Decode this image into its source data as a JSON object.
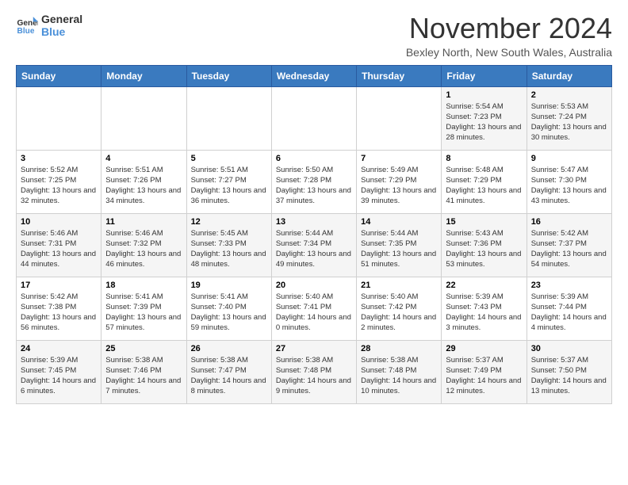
{
  "header": {
    "logo_line1": "General",
    "logo_line2": "Blue",
    "month": "November 2024",
    "location": "Bexley North, New South Wales, Australia"
  },
  "weekdays": [
    "Sunday",
    "Monday",
    "Tuesday",
    "Wednesday",
    "Thursday",
    "Friday",
    "Saturday"
  ],
  "weeks": [
    [
      {
        "day": "",
        "info": ""
      },
      {
        "day": "",
        "info": ""
      },
      {
        "day": "",
        "info": ""
      },
      {
        "day": "",
        "info": ""
      },
      {
        "day": "",
        "info": ""
      },
      {
        "day": "1",
        "info": "Sunrise: 5:54 AM\nSunset: 7:23 PM\nDaylight: 13 hours and 28 minutes."
      },
      {
        "day": "2",
        "info": "Sunrise: 5:53 AM\nSunset: 7:24 PM\nDaylight: 13 hours and 30 minutes."
      }
    ],
    [
      {
        "day": "3",
        "info": "Sunrise: 5:52 AM\nSunset: 7:25 PM\nDaylight: 13 hours and 32 minutes."
      },
      {
        "day": "4",
        "info": "Sunrise: 5:51 AM\nSunset: 7:26 PM\nDaylight: 13 hours and 34 minutes."
      },
      {
        "day": "5",
        "info": "Sunrise: 5:51 AM\nSunset: 7:27 PM\nDaylight: 13 hours and 36 minutes."
      },
      {
        "day": "6",
        "info": "Sunrise: 5:50 AM\nSunset: 7:28 PM\nDaylight: 13 hours and 37 minutes."
      },
      {
        "day": "7",
        "info": "Sunrise: 5:49 AM\nSunset: 7:29 PM\nDaylight: 13 hours and 39 minutes."
      },
      {
        "day": "8",
        "info": "Sunrise: 5:48 AM\nSunset: 7:29 PM\nDaylight: 13 hours and 41 minutes."
      },
      {
        "day": "9",
        "info": "Sunrise: 5:47 AM\nSunset: 7:30 PM\nDaylight: 13 hours and 43 minutes."
      }
    ],
    [
      {
        "day": "10",
        "info": "Sunrise: 5:46 AM\nSunset: 7:31 PM\nDaylight: 13 hours and 44 minutes."
      },
      {
        "day": "11",
        "info": "Sunrise: 5:46 AM\nSunset: 7:32 PM\nDaylight: 13 hours and 46 minutes."
      },
      {
        "day": "12",
        "info": "Sunrise: 5:45 AM\nSunset: 7:33 PM\nDaylight: 13 hours and 48 minutes."
      },
      {
        "day": "13",
        "info": "Sunrise: 5:44 AM\nSunset: 7:34 PM\nDaylight: 13 hours and 49 minutes."
      },
      {
        "day": "14",
        "info": "Sunrise: 5:44 AM\nSunset: 7:35 PM\nDaylight: 13 hours and 51 minutes."
      },
      {
        "day": "15",
        "info": "Sunrise: 5:43 AM\nSunset: 7:36 PM\nDaylight: 13 hours and 53 minutes."
      },
      {
        "day": "16",
        "info": "Sunrise: 5:42 AM\nSunset: 7:37 PM\nDaylight: 13 hours and 54 minutes."
      }
    ],
    [
      {
        "day": "17",
        "info": "Sunrise: 5:42 AM\nSunset: 7:38 PM\nDaylight: 13 hours and 56 minutes."
      },
      {
        "day": "18",
        "info": "Sunrise: 5:41 AM\nSunset: 7:39 PM\nDaylight: 13 hours and 57 minutes."
      },
      {
        "day": "19",
        "info": "Sunrise: 5:41 AM\nSunset: 7:40 PM\nDaylight: 13 hours and 59 minutes."
      },
      {
        "day": "20",
        "info": "Sunrise: 5:40 AM\nSunset: 7:41 PM\nDaylight: 14 hours and 0 minutes."
      },
      {
        "day": "21",
        "info": "Sunrise: 5:40 AM\nSunset: 7:42 PM\nDaylight: 14 hours and 2 minutes."
      },
      {
        "day": "22",
        "info": "Sunrise: 5:39 AM\nSunset: 7:43 PM\nDaylight: 14 hours and 3 minutes."
      },
      {
        "day": "23",
        "info": "Sunrise: 5:39 AM\nSunset: 7:44 PM\nDaylight: 14 hours and 4 minutes."
      }
    ],
    [
      {
        "day": "24",
        "info": "Sunrise: 5:39 AM\nSunset: 7:45 PM\nDaylight: 14 hours and 6 minutes."
      },
      {
        "day": "25",
        "info": "Sunrise: 5:38 AM\nSunset: 7:46 PM\nDaylight: 14 hours and 7 minutes."
      },
      {
        "day": "26",
        "info": "Sunrise: 5:38 AM\nSunset: 7:47 PM\nDaylight: 14 hours and 8 minutes."
      },
      {
        "day": "27",
        "info": "Sunrise: 5:38 AM\nSunset: 7:48 PM\nDaylight: 14 hours and 9 minutes."
      },
      {
        "day": "28",
        "info": "Sunrise: 5:38 AM\nSunset: 7:48 PM\nDaylight: 14 hours and 10 minutes."
      },
      {
        "day": "29",
        "info": "Sunrise: 5:37 AM\nSunset: 7:49 PM\nDaylight: 14 hours and 12 minutes."
      },
      {
        "day": "30",
        "info": "Sunrise: 5:37 AM\nSunset: 7:50 PM\nDaylight: 14 hours and 13 minutes."
      }
    ]
  ]
}
